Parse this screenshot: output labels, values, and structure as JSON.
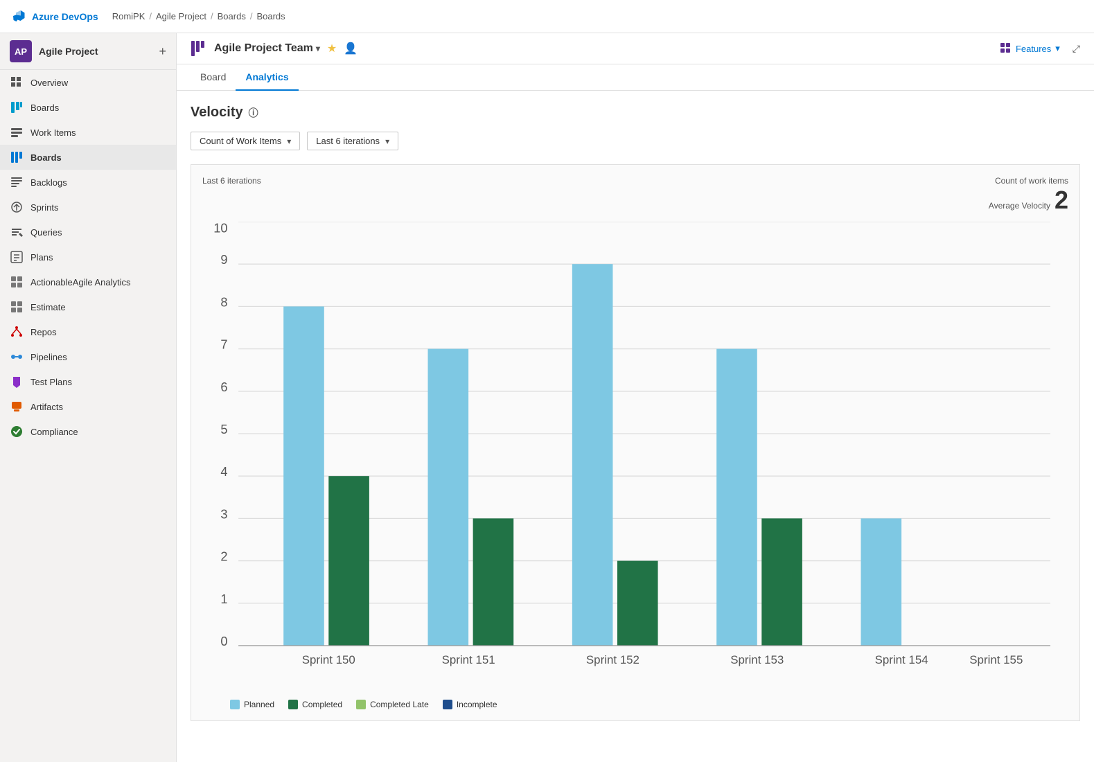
{
  "topbar": {
    "logo_text": "Azure DevOps",
    "breadcrumbs": [
      "RomiPK",
      "Agile Project",
      "Boards",
      "Boards"
    ]
  },
  "sidebar": {
    "project_name": "Agile Project",
    "avatar_initials": "AP",
    "items": [
      {
        "id": "overview",
        "label": "Overview",
        "icon": "overview"
      },
      {
        "id": "boards-parent",
        "label": "Boards",
        "icon": "boards",
        "active": false
      },
      {
        "id": "work-items",
        "label": "Work Items",
        "icon": "workitems"
      },
      {
        "id": "boards",
        "label": "Boards",
        "icon": "boards2",
        "active": true
      },
      {
        "id": "backlogs",
        "label": "Backlogs",
        "icon": "backlogs"
      },
      {
        "id": "sprints",
        "label": "Sprints",
        "icon": "sprints"
      },
      {
        "id": "queries",
        "label": "Queries",
        "icon": "queries"
      },
      {
        "id": "plans",
        "label": "Plans",
        "icon": "plans"
      },
      {
        "id": "actionable",
        "label": "ActionableAgile Analytics",
        "icon": "actionable"
      },
      {
        "id": "estimate",
        "label": "Estimate",
        "icon": "estimate"
      },
      {
        "id": "repos",
        "label": "Repos",
        "icon": "repos"
      },
      {
        "id": "pipelines",
        "label": "Pipelines",
        "icon": "pipelines"
      },
      {
        "id": "test-plans",
        "label": "Test Plans",
        "icon": "testplans"
      },
      {
        "id": "artifacts",
        "label": "Artifacts",
        "icon": "artifacts"
      },
      {
        "id": "compliance",
        "label": "Compliance",
        "icon": "compliance"
      }
    ]
  },
  "header": {
    "team_name": "Agile Project Team",
    "features_label": "Features",
    "tab_board": "Board",
    "tab_analytics": "Analytics"
  },
  "velocity": {
    "title": "Velocity",
    "filter_metric": "Count of Work Items",
    "filter_iterations": "Last 6 iterations",
    "chart_label": "Last 6 iterations",
    "count_label": "Count of work items",
    "avg_velocity_label": "Average Velocity",
    "avg_velocity_value": "2",
    "sprints": [
      "Sprint 150",
      "Sprint 151",
      "Sprint 152",
      "Sprint 153",
      "Sprint 154",
      "Sprint 155"
    ],
    "planned": [
      8,
      7,
      9,
      7,
      3,
      0
    ],
    "completed": [
      4,
      3,
      2,
      3,
      0,
      0
    ],
    "completed_late": [
      0,
      0,
      0,
      0,
      0,
      0
    ],
    "incomplete": [
      0,
      0,
      0,
      0,
      0,
      0
    ],
    "y_max": 10,
    "legend": [
      {
        "label": "Planned",
        "color": "#7ec8e3"
      },
      {
        "label": "Completed",
        "color": "#217346"
      },
      {
        "label": "Completed Late",
        "color": "#92c36a"
      },
      {
        "label": "Incomplete",
        "color": "#1e4d8c"
      }
    ]
  }
}
